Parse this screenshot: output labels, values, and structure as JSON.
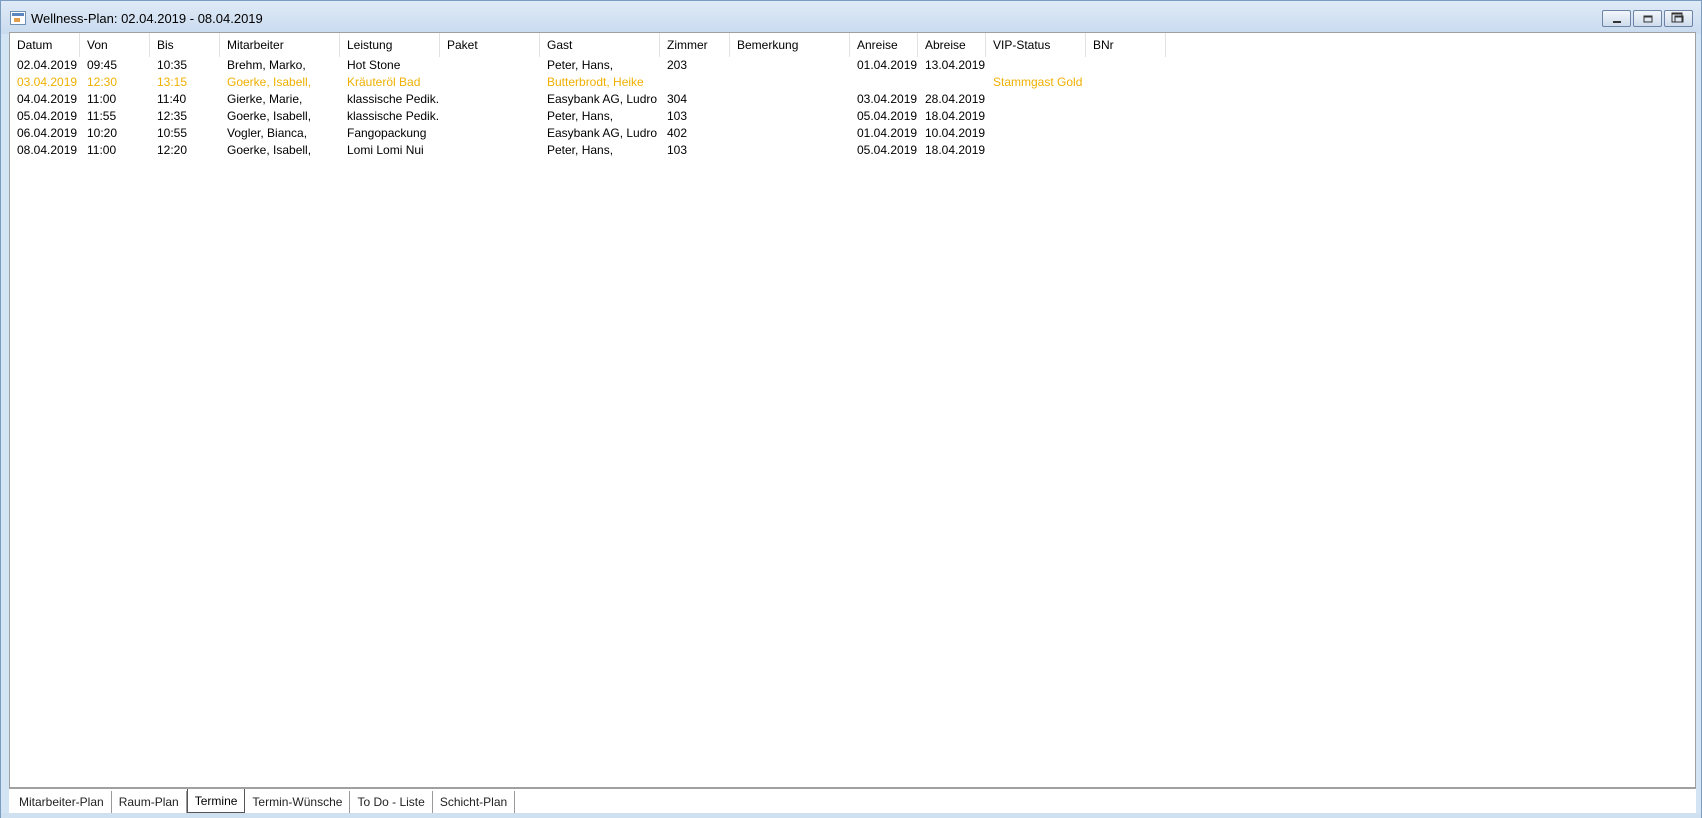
{
  "window": {
    "title": "Wellness-Plan: 02.04.2019 - 08.04.2019"
  },
  "colors": {
    "highlight_text": "#f0b000",
    "titlebar": "#c9dbef"
  },
  "table": {
    "columns": [
      "Datum",
      "Von",
      "Bis",
      "Mitarbeiter",
      "Leistung",
      "Paket",
      "Gast",
      "Zimmer",
      "Bemerkung",
      "Anreise",
      "Abreise",
      "VIP-Status",
      "BNr"
    ],
    "rows": [
      {
        "highlight": false,
        "cells": [
          "02.04.2019",
          "09:45",
          "10:35",
          "Brehm, Marko,",
          "Hot Stone",
          "",
          "Peter, Hans,",
          "203",
          "",
          "01.04.2019",
          "13.04.2019",
          "",
          ""
        ]
      },
      {
        "highlight": true,
        "cells": [
          "03.04.2019",
          "12:30",
          "13:15",
          "Goerke, Isabell,",
          "Kräuteröl Bad",
          "",
          "Butterbrodt, Heike",
          "",
          "",
          "",
          "",
          "Stammgast Gold",
          ""
        ]
      },
      {
        "highlight": false,
        "cells": [
          "04.04.2019",
          "11:00",
          "11:40",
          "Gierke, Marie,",
          "klassische Pedik...",
          "",
          "Easybank AG, Ludro",
          "304",
          "",
          "03.04.2019",
          "28.04.2019",
          "",
          ""
        ]
      },
      {
        "highlight": false,
        "cells": [
          "05.04.2019",
          "11:55",
          "12:35",
          "Goerke, Isabell,",
          "klassische Pedik...",
          "",
          "Peter, Hans,",
          "103",
          "",
          "05.04.2019",
          "18.04.2019",
          "",
          ""
        ]
      },
      {
        "highlight": false,
        "cells": [
          "06.04.2019",
          "10:20",
          "10:55",
          "Vogler, Bianca,",
          "Fangopackung",
          "",
          "Easybank AG, Ludro",
          "402",
          "",
          "01.04.2019",
          "10.04.2019",
          "",
          ""
        ]
      },
      {
        "highlight": false,
        "cells": [
          "08.04.2019",
          "11:00",
          "12:20",
          "Goerke, Isabell,",
          "Lomi Lomi Nui",
          "",
          "Peter, Hans,",
          "103",
          "",
          "05.04.2019",
          "18.04.2019",
          "",
          ""
        ]
      }
    ]
  },
  "tabs": [
    "Mitarbeiter-Plan",
    "Raum-Plan",
    "Termine",
    "Termin-Wünsche",
    "To Do - Liste",
    "Schicht-Plan"
  ],
  "active_tab": "Termine"
}
